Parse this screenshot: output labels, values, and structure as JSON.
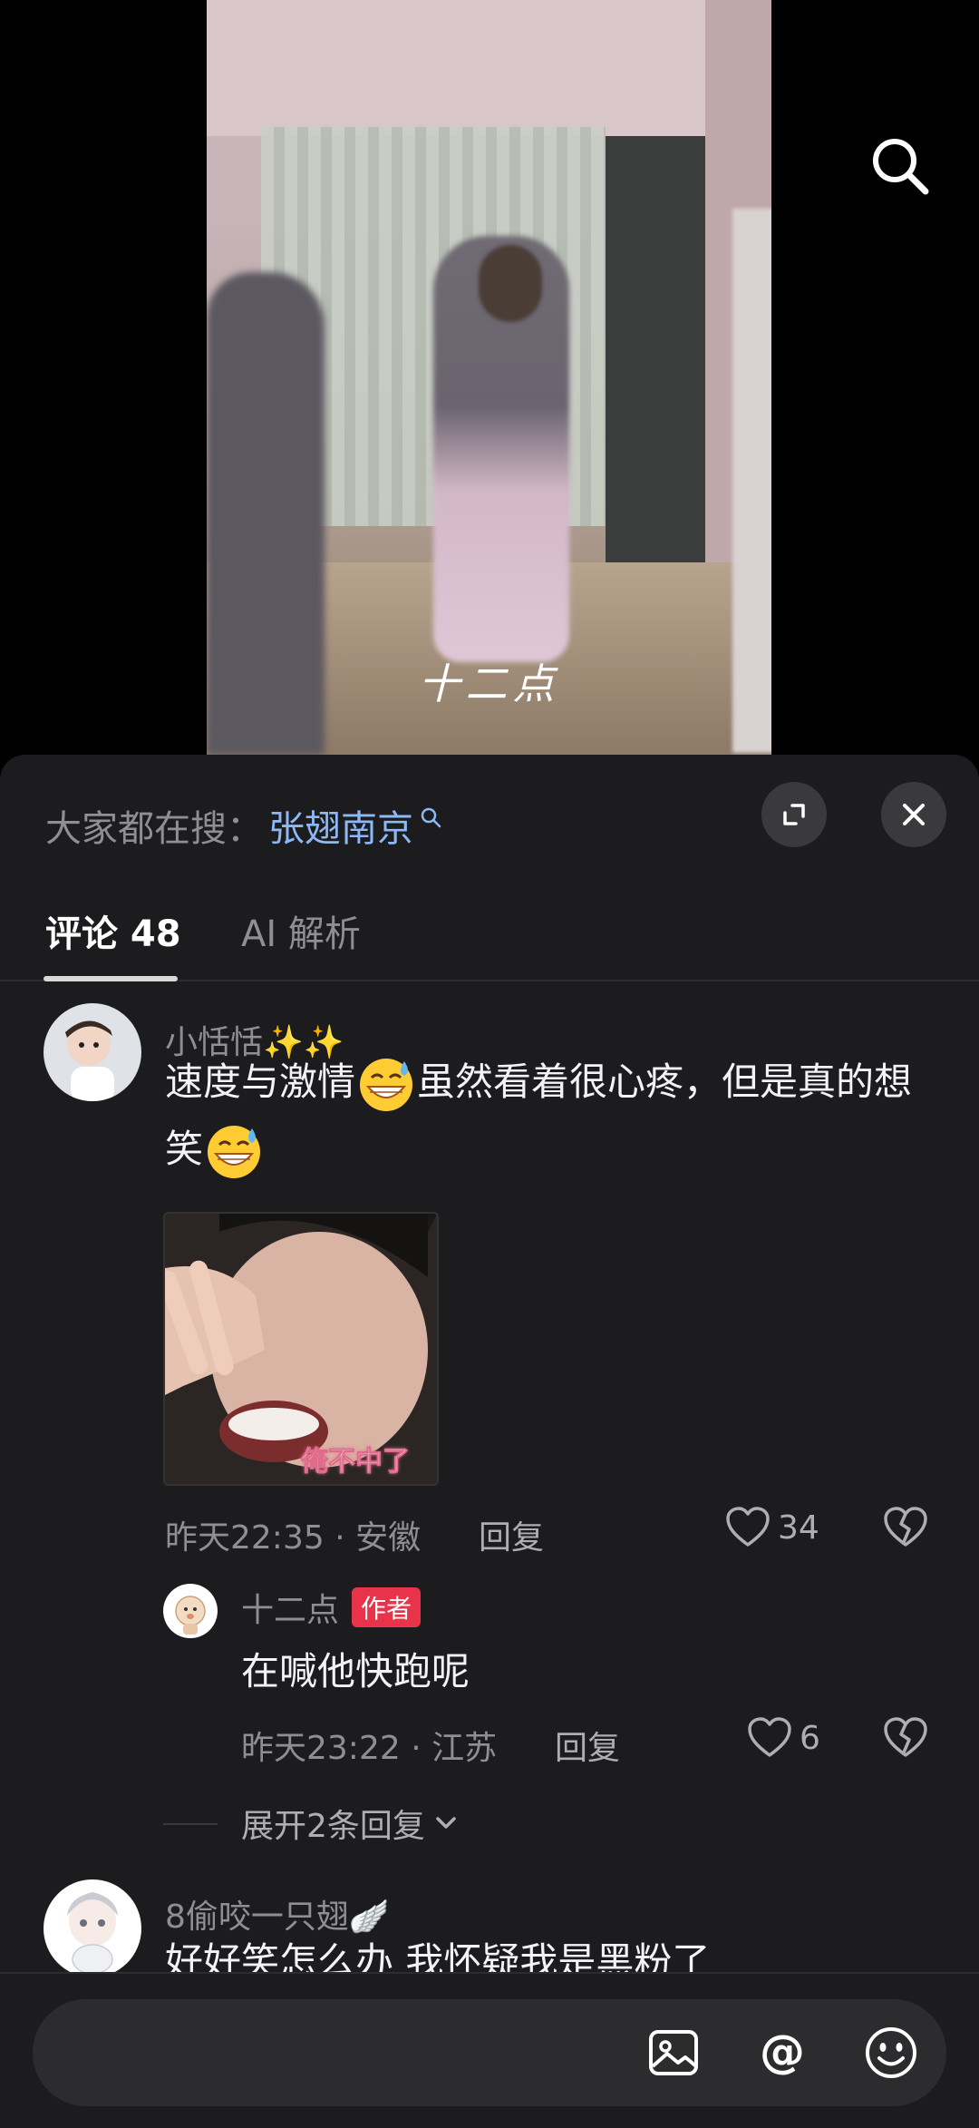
{
  "video": {
    "watermark": "十二点"
  },
  "sheet": {
    "trending_label": "大家都在搜：",
    "trending_keyword": "张翅南京",
    "tabs": [
      {
        "label": "评论 48"
      },
      {
        "label": "AI 解析"
      }
    ]
  },
  "comments": [
    {
      "username": "小恬恬✨✨",
      "text_part1": "速度与激情",
      "text_part2": "虽然看着很心疼，但是真的想笑",
      "image_caption": "俺不中了",
      "time_location": "昨天22:35 · 安徽",
      "reply_label": "回复",
      "likes": "34",
      "reply": {
        "username": "十二点",
        "badge": "作者",
        "text": "在喊他快跑呢",
        "time_location": "昨天23:22 · 江苏",
        "reply_label": "回复",
        "likes": "6"
      },
      "expand_label": "展开2条回复"
    },
    {
      "username": "8偷咬一只翅🪽",
      "text": "好好笑怎么办 我怀疑我是黑粉了"
    }
  ],
  "input": {
    "placeholder": ""
  },
  "colors": {
    "sheet_bg": "#1c1c1e",
    "accent_link": "#8cb8f5",
    "author_badge": "#e8344a"
  }
}
